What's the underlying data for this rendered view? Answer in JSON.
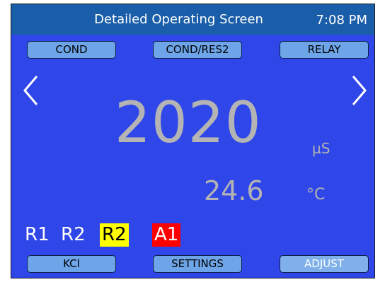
{
  "header": {
    "title": "Detailed Operating Screen",
    "time": "7:08 PM"
  },
  "top_buttons": [
    {
      "label": "COND"
    },
    {
      "label": "COND/RES2"
    },
    {
      "label": "RELAY"
    }
  ],
  "navigation": {
    "prev_icon": "chevron-left-icon",
    "next_icon": "chevron-right-icon"
  },
  "reading": {
    "value": "2020",
    "unit": "µS"
  },
  "temperature": {
    "value": "24.6",
    "unit": "°C"
  },
  "status_indicators": [
    {
      "label": "R1",
      "highlight": "none"
    },
    {
      "label": "R2",
      "highlight": "none"
    },
    {
      "label": "R2",
      "highlight": "#ffff00"
    },
    {
      "label": "A1",
      "highlight": "#ff0000"
    }
  ],
  "bottom_buttons": [
    {
      "label": "KCl"
    },
    {
      "label": "SETTINGS"
    },
    {
      "label": "ADJUST"
    }
  ],
  "colors": {
    "screen_background": "#2f46e8",
    "titlebar": "#1a5da8",
    "button": "#6ea5e8",
    "reading_text": "#b4b4b4"
  }
}
